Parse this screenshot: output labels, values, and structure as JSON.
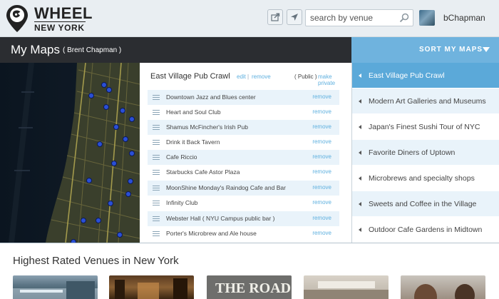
{
  "header": {
    "logo_line1": "WHEEL",
    "logo_line2": "NEW YORK",
    "search": {
      "placeholder": "search by venue"
    },
    "username": "bChapman"
  },
  "mymaps": {
    "title": "My Maps",
    "owner": "( Brent Chapman )"
  },
  "sort": {
    "label": "SORT MY MAPS",
    "items": [
      {
        "label": "East Village Pub Crawl",
        "active": true
      },
      {
        "label": "Modern Art Galleries and Museums"
      },
      {
        "label": "Japan's Finest Sushi Tour of NYC"
      },
      {
        "label": "Favorite Diners of Uptown"
      },
      {
        "label": "Microbrews and specialty shops"
      },
      {
        "label": "Sweets and Coffee in the Village"
      },
      {
        "label": "Outdoor Cafe Gardens in Midtown"
      }
    ]
  },
  "list": {
    "name": "East Village Pub Crawl",
    "edit": "edit",
    "sep": "|",
    "remove": "remove",
    "visibility": "( Public )",
    "make_private": "make private",
    "remove_label": "remove",
    "venues": [
      {
        "name": "Downtown Jazz and Blues center"
      },
      {
        "name": "Heart and Soul Club"
      },
      {
        "name": "Shamus McFincher's Irish Pub"
      },
      {
        "name": "Drink it Back Tavern"
      },
      {
        "name": "Cafe Riccio"
      },
      {
        "name": "Starbucks Cafe Astor Plaza"
      },
      {
        "name": "MoonShine Monday's Raindog Cafe and Bar"
      },
      {
        "name": "Infinity Club"
      },
      {
        "name": "Webster Hall ( NYU Campus public bar )"
      },
      {
        "name": "Porter's Microbrew and Ale house"
      }
    ]
  },
  "highest": {
    "title": "Highest Rated Venues in New York",
    "thumb_text": "THE ROAD TO"
  },
  "colors": {
    "accent": "#6fb3de",
    "active": "#5ba9d9",
    "dark_bar": "#2b2d31",
    "row_alt": "#e9f3fa",
    "link": "#5fb0df"
  }
}
